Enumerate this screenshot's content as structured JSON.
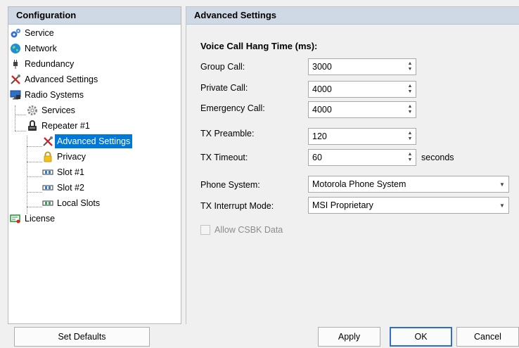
{
  "left_panel": {
    "header": "Configuration",
    "tree": [
      {
        "label": "Service",
        "icon": "gears-icon"
      },
      {
        "label": "Network",
        "icon": "globe-icon"
      },
      {
        "label": "Redundancy",
        "icon": "plug-icon"
      },
      {
        "label": "Advanced Settings",
        "icon": "tools-icon"
      },
      {
        "label": "Radio Systems",
        "icon": "monitor-icon"
      },
      {
        "label": "Services",
        "icon": "gear-icon"
      },
      {
        "label": "Repeater #1",
        "icon": "repeater-icon"
      },
      {
        "label": "Advanced Settings",
        "icon": "tools-icon",
        "selected": true
      },
      {
        "label": "Privacy",
        "icon": "lock-icon"
      },
      {
        "label": "Slot #1",
        "icon": "slot-icon"
      },
      {
        "label": "Slot #2",
        "icon": "slot-icon"
      },
      {
        "label": "Local Slots",
        "icon": "local-slot-icon"
      },
      {
        "label": "License",
        "icon": "license-icon"
      }
    ]
  },
  "right_panel": {
    "header": "Advanced Settings",
    "section_title": "Voice Call Hang Time (ms):",
    "fields": {
      "group_call": {
        "label": "Group Call:",
        "value": "3000"
      },
      "private_call": {
        "label": "Private Call:",
        "value": "4000"
      },
      "emergency_call": {
        "label": "Emergency Call:",
        "value": "4000"
      },
      "tx_preamble": {
        "label": "TX Preamble:",
        "value": "120"
      },
      "tx_timeout": {
        "label": "TX Timeout:",
        "value": "60",
        "suffix": "seconds"
      },
      "phone_system": {
        "label": "Phone System:",
        "value": "Motorola Phone System"
      },
      "tx_interrupt_mode": {
        "label": "TX Interrupt Mode:",
        "value": "MSI Proprietary"
      }
    },
    "allow_csbk": {
      "label": "Allow CSBK Data",
      "checked": false,
      "enabled": false
    }
  },
  "buttons": {
    "set_defaults": "Set Defaults",
    "apply": "Apply",
    "ok": "OK",
    "cancel": "Cancel"
  },
  "colors": {
    "header_bg": "#cfd9e6",
    "selection": "#0078d7",
    "ok_border": "#2f6ecb"
  }
}
